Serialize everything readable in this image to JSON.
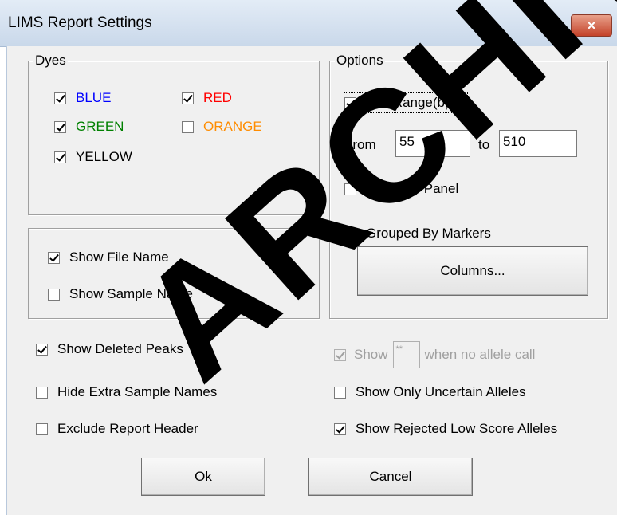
{
  "window": {
    "title": "LIMS Report Settings",
    "close_glyph": "×"
  },
  "dyes": {
    "legend": "Dyes",
    "items": [
      {
        "label": "BLUE",
        "checked": true,
        "color": "#0000ff"
      },
      {
        "label": "RED",
        "checked": true,
        "color": "#ff0000"
      },
      {
        "label": "GREEN",
        "checked": true,
        "color": "#008000"
      },
      {
        "label": "ORANGE",
        "checked": false,
        "color": "#ff8c00"
      },
      {
        "label": "YELLOW",
        "checked": true,
        "color": "#000000"
      }
    ]
  },
  "options": {
    "legend": "Options",
    "size_range_label": "Size Range(bps)",
    "size_range_checked": true,
    "from_label": "From",
    "from_value": "55",
    "to_label": "to",
    "to_value": "510",
    "abide_by_panel_label": "Abide By Panel",
    "grouped_by_markers_label": "Grouped By Markers",
    "columns_button": "Columns..."
  },
  "names_group": {
    "show_file_name": "Show File Name",
    "show_sample_name": "Show Sample Name"
  },
  "bottom_left": {
    "show_deleted_peaks": "Show Deleted Peaks",
    "hide_extra_sample_names": "Hide Extra Sample Names",
    "exclude_report_header": "Exclude Report Header"
  },
  "bottom_right": {
    "show_label": "Show",
    "show_value": "**",
    "no_allele_label": "when no allele call",
    "show_only_uncertain": "Show Only Uncertain Alleles",
    "show_rejected_low_score": "Show Rejected Low Score Alleles"
  },
  "buttons": {
    "ok": "Ok",
    "cancel": "Cancel"
  },
  "watermark": "ARCHIVED",
  "colors": {
    "titlebar": "#c9d8ea",
    "dialog_bg": "#f0f0f0",
    "close_button": "#c4432a"
  }
}
